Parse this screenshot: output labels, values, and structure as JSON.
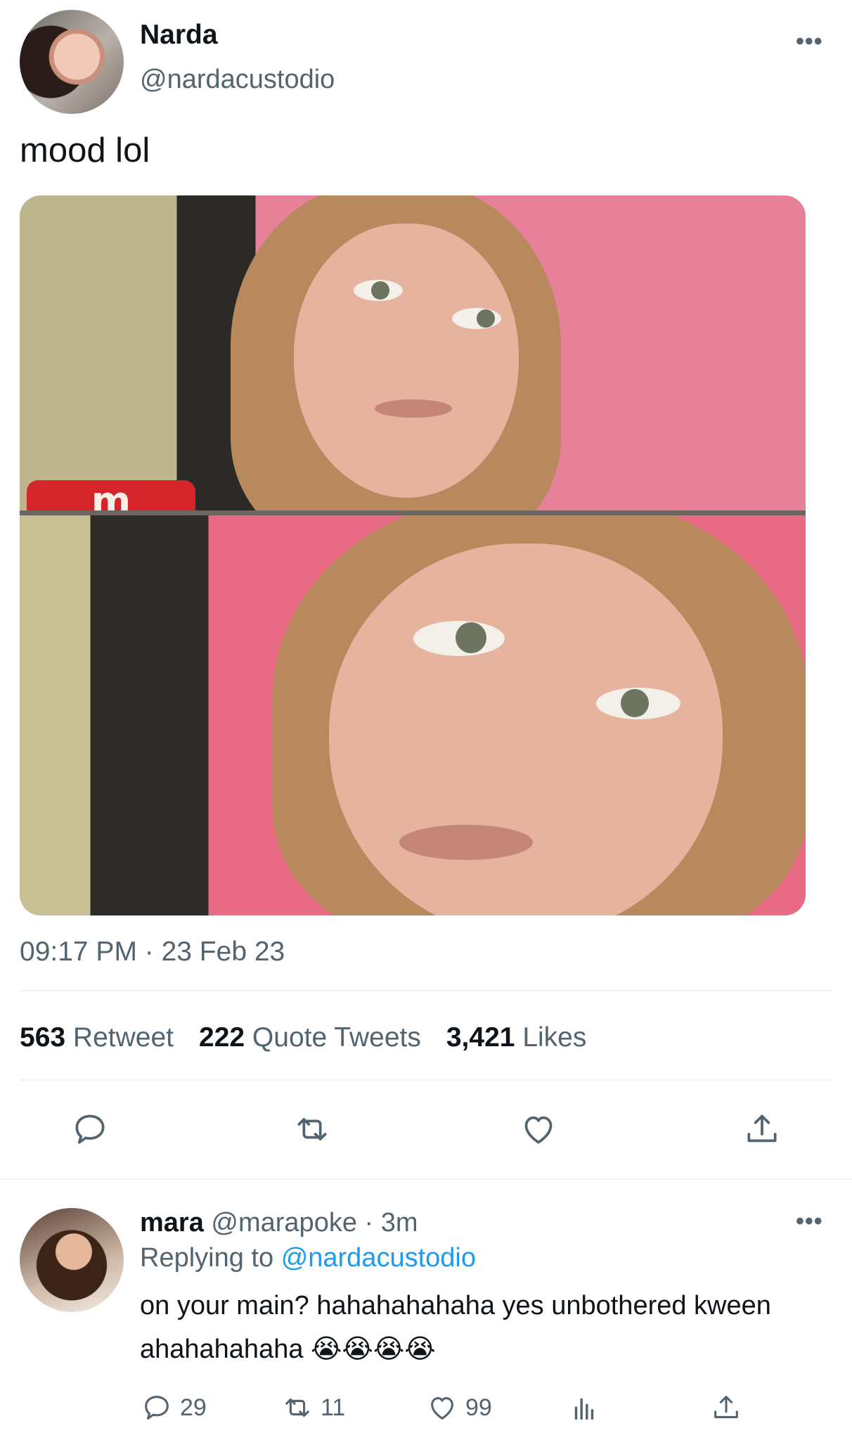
{
  "tweet": {
    "author_name": "Narda",
    "author_handle": "@nardacustodio",
    "text": "mood lol",
    "media_watermark": "m",
    "timestamp": "09:17 PM · 23 Feb 23",
    "stats": [
      {
        "count": "563",
        "label": "Retweet"
      },
      {
        "count": "222",
        "label": "Quote Tweets"
      },
      {
        "count": "3,421",
        "label": "Likes"
      }
    ],
    "actions": [
      "reply-icon",
      "retweet-icon",
      "like-icon",
      "share-icon"
    ]
  },
  "reply": {
    "name": "mara",
    "handle": "@marapoke",
    "time": "· 3m",
    "replying_prefix": "Replying to",
    "replying_handle": "@nardacustodio",
    "text": "on your main? hahahahahaha yes unbothered kween ahahahahaha 😭😭😭😭",
    "counts": {
      "replies": "29",
      "retweets": "11",
      "likes": "99"
    }
  },
  "more_label": "•••",
  "colors": {
    "text": "#0f1419",
    "secondary": "#536471",
    "link": "#1d9bf0",
    "divider": "#eff3f4"
  }
}
